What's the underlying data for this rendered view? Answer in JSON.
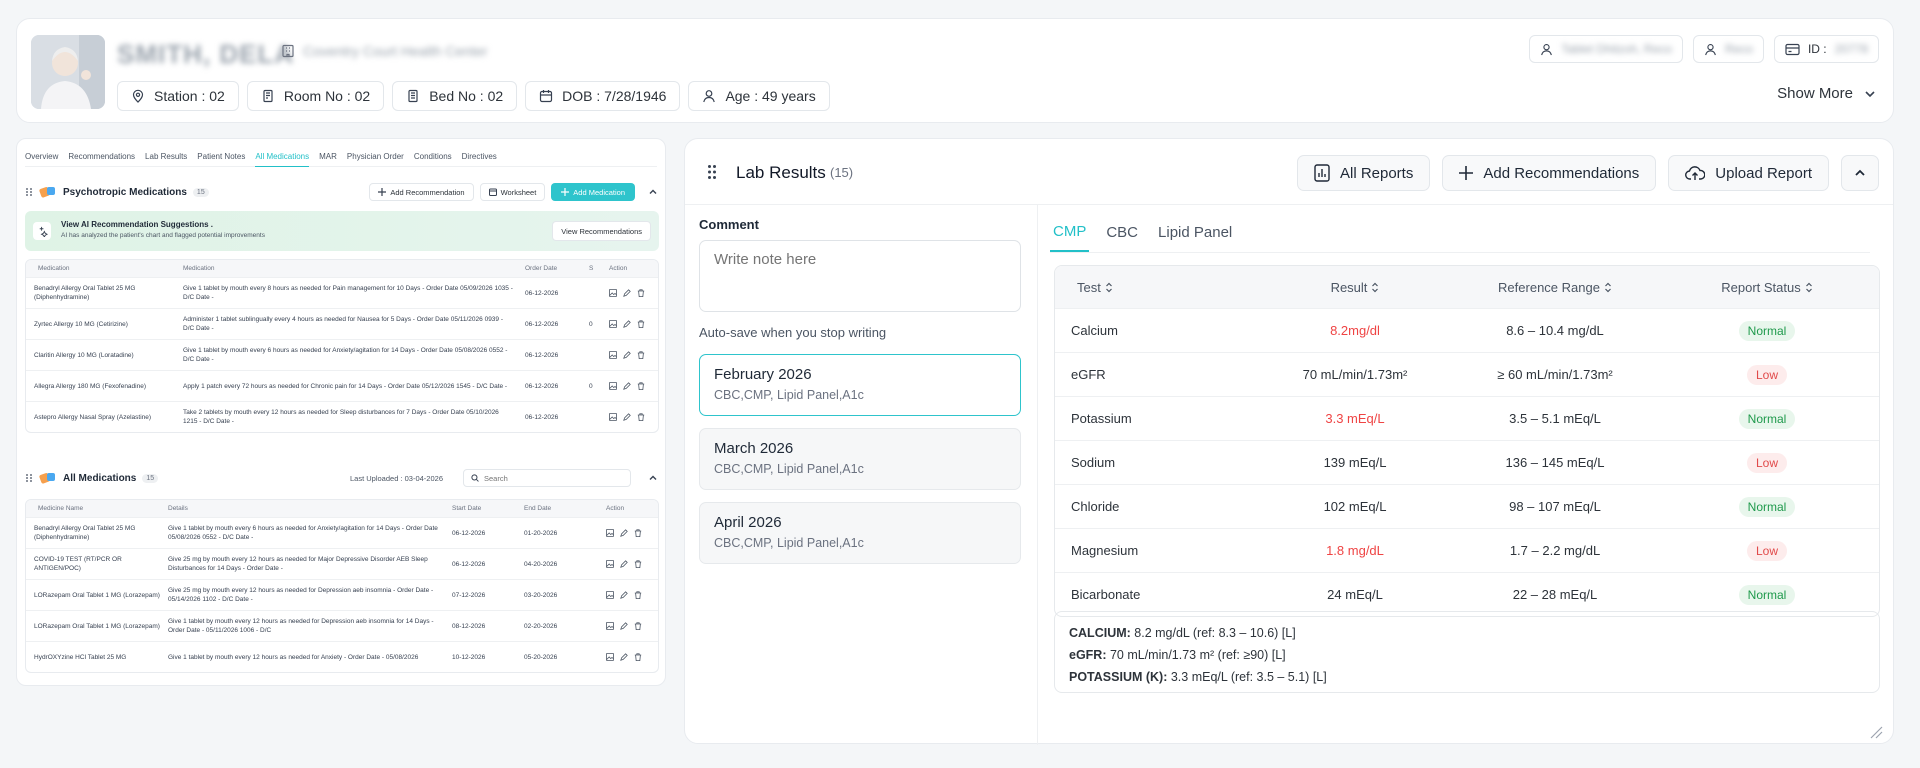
{
  "header": {
    "patient_name": "SMITH, DELA",
    "facility": "Coventry Court Health Center",
    "chips": {
      "station": "Station : 02",
      "room": "Room No : 02",
      "bed": "Bed No : 02",
      "dob": "DOB : 7/28/1946",
      "age": "Age : 49 years"
    },
    "right_chips": {
      "provider": "Tablet Dhitzoh, Reco",
      "nurse": "Reco",
      "id_label": "ID :",
      "id_value": "20778"
    },
    "show_more": "Show More"
  },
  "tabs": [
    "Overview",
    "Recommendations",
    "Lab Results",
    "Patient Notes",
    "All Medications",
    "MAR",
    "Physician Order",
    "Conditions",
    "Directives"
  ],
  "psychotropic": {
    "title": "Psychotropic Medications",
    "count": "15",
    "add_recommendation": "Add Recommendation",
    "worksheet": "Worksheet",
    "add_medication": "Add Medication",
    "ai_title": "View AI Recommendation Suggestions .",
    "ai_sub": "AI has analyzed the patient's chart and flagged potential improvements",
    "view_recommendations": "View Recommendations",
    "columns": {
      "medication": "Medication",
      "details": "Medication",
      "order_date": "Order Date",
      "s": "S",
      "action": "Action"
    },
    "rows": [
      {
        "name": "Benadryl Allergy Oral Tablet 25 MG (Diphenhydramine)",
        "details": "Give 1 tablet by mouth every 8 hours as needed for Pain management for 10 Days - Order Date 05/09/2026 1035 - D/C Date -",
        "date": "06-12-2026",
        "s": ""
      },
      {
        "name": "Zyrtec Allergy 10 MG (Cetirizine)",
        "details": "Administer 1 tablet sublingually every 4 hours as needed for Nausea for 5 Days - Order Date 05/11/2026 0939 - D/C Date -",
        "date": "06-12-2026",
        "s": "0"
      },
      {
        "name": "Claritin Allergy 10 MG (Loratadine)",
        "details": "Give 1 tablet by mouth every 6 hours as needed for Anxiety/agitation for 14 Days - Order Date 05/08/2026 0552 - D/C Date -",
        "date": "06-12-2026",
        "s": ""
      },
      {
        "name": "Allegra Allergy 180 MG (Fexofenadine)",
        "details": "Apply 1 patch every 72 hours as needed for Chronic pain for 14 Days - Order Date 05/12/2026 1545 - D/C Date -",
        "date": "06-12-2026",
        "s": "0"
      },
      {
        "name": "Astepro Allergy Nasal Spray (Azelastine)",
        "details": "Take 2 tablets by mouth every 12 hours as needed for Sleep disturbances for 7 Days - Order Date 05/10/2026 1215 - D/C Date -",
        "date": "06-12-2026",
        "s": ""
      }
    ]
  },
  "allmeds": {
    "title": "All Medications",
    "count": "15",
    "last_uploaded": "Last Uploaded : 03-04-2026",
    "search_placeholder": "Search",
    "columns": {
      "name": "Medicine Name",
      "details": "Details",
      "start": "Start Date",
      "end": "End Date",
      "action": "Action"
    },
    "rows": [
      {
        "name": "Benadryl Allergy Oral Tablet 25 MG (Diphenhydramine)",
        "details": "Give 1 tablet by mouth every 6 hours as needed for Anxiety/agitation for 14 Days - Order Date 05/08/2026 0552 - D/C Date -",
        "start": "06-12-2026",
        "end": "01-20-2026"
      },
      {
        "name": "COVID-19 TEST (RT/PCR OR ANTIGEN/POC)",
        "details": "Give 25 mg by mouth every 12 hours as needed for Major Depressive Disorder AEB Sleep Disturbances for 14 Days - Order Date -",
        "start": "06-12-2026",
        "end": "04-20-2026"
      },
      {
        "name": "LORazepam Oral Tablet 1 MG (Lorazepam)",
        "details": "Give 25 mg by mouth every 12 hours as needed for Depression aeb insomnia - Order Date - 05/14/2026 1102 - D/C Date -",
        "start": "07-12-2026",
        "end": "03-20-2026"
      },
      {
        "name": "LORazepam Oral Tablet 1 MG (Lorazepam)",
        "details": "Give 1 tablet by mouth every 12 hours as needed for Depression aeb insomnia for 14 Days - Order Date - 05/11/2026 1006 - D/C",
        "start": "08-12-2026",
        "end": "02-20-2026"
      },
      {
        "name": "HydrOXYzine HCl Tablet 25 MG",
        "details": "Give 1 tablet by mouth every 12 hours as needed for Anxiety - Order Date - 05/08/2026",
        "start": "10-12-2026",
        "end": "05-20-2026"
      }
    ]
  },
  "lab": {
    "title": "Lab Results",
    "count": "(15)",
    "all_reports": "All Reports",
    "add_recommendations": "Add Recommendations",
    "upload_report": "Upload Report",
    "comment_label": "Comment",
    "comment_placeholder": "Write note here",
    "autosave": "Auto-save when you stop writing",
    "reports": [
      {
        "title": "February 2026",
        "sub": "CBC,CMP, Lipid Panel,A1c"
      },
      {
        "title": "March 2026",
        "sub": "CBC,CMP, Lipid Panel,A1c"
      },
      {
        "title": "April 2026",
        "sub": "CBC,CMP, Lipid Panel,A1c"
      }
    ],
    "subtabs": [
      "CMP",
      "CBC",
      "Lipid Panel"
    ],
    "columns": {
      "test": "Test",
      "result": "Result",
      "range": "Reference Range",
      "status": "Report Status"
    },
    "rows": [
      {
        "test": "Calcium",
        "result": "8.2mg/dl",
        "range": "8.6 – 10.4 mg/dL",
        "status": "Normal",
        "flag": true
      },
      {
        "test": "eGFR",
        "result": "70 mL/min/1.73m²",
        "range": "≥ 60 mL/min/1.73m²",
        "status": "Low",
        "flag": false
      },
      {
        "test": "Potassium",
        "result": "3.3 mEq/L",
        "range": "3.5 – 5.1 mEq/L",
        "status": "Normal",
        "flag": true
      },
      {
        "test": "Sodium",
        "result": "139 mEq/L",
        "range": "136 – 145 mEq/L",
        "status": "Low",
        "flag": false
      },
      {
        "test": "Chloride",
        "result": "102 mEq/L",
        "range": "98 – 107 mEq/L",
        "status": "Normal",
        "flag": false
      },
      {
        "test": "Magnesium",
        "result": "1.8 mg/dL",
        "range": "1.7 – 2.2 mg/dL",
        "status": "Low",
        "flag": true
      },
      {
        "test": "Bicarbonate",
        "result": "24 mEq/L",
        "range": "22 – 28 mEq/L",
        "status": "Normal",
        "flag": false
      }
    ],
    "summary": [
      {
        "label": "CALCIUM:",
        "text": " 8.2 mg/dL (ref: 8.3 – 10.6) [L]"
      },
      {
        "label": "eGFR:",
        "text": " 70 mL/min/1.73 m² (ref: ≥90) [L]"
      },
      {
        "label": "POTASSIUM (K):",
        "text": " 3.3 mEq/L (ref: 3.5 – 5.1) [L]"
      }
    ]
  },
  "colors": {
    "accent": "#2ec4cc",
    "flag_red": "#ef4444",
    "normal_green": "#1f9a4c",
    "low_red": "#e14a4a"
  }
}
